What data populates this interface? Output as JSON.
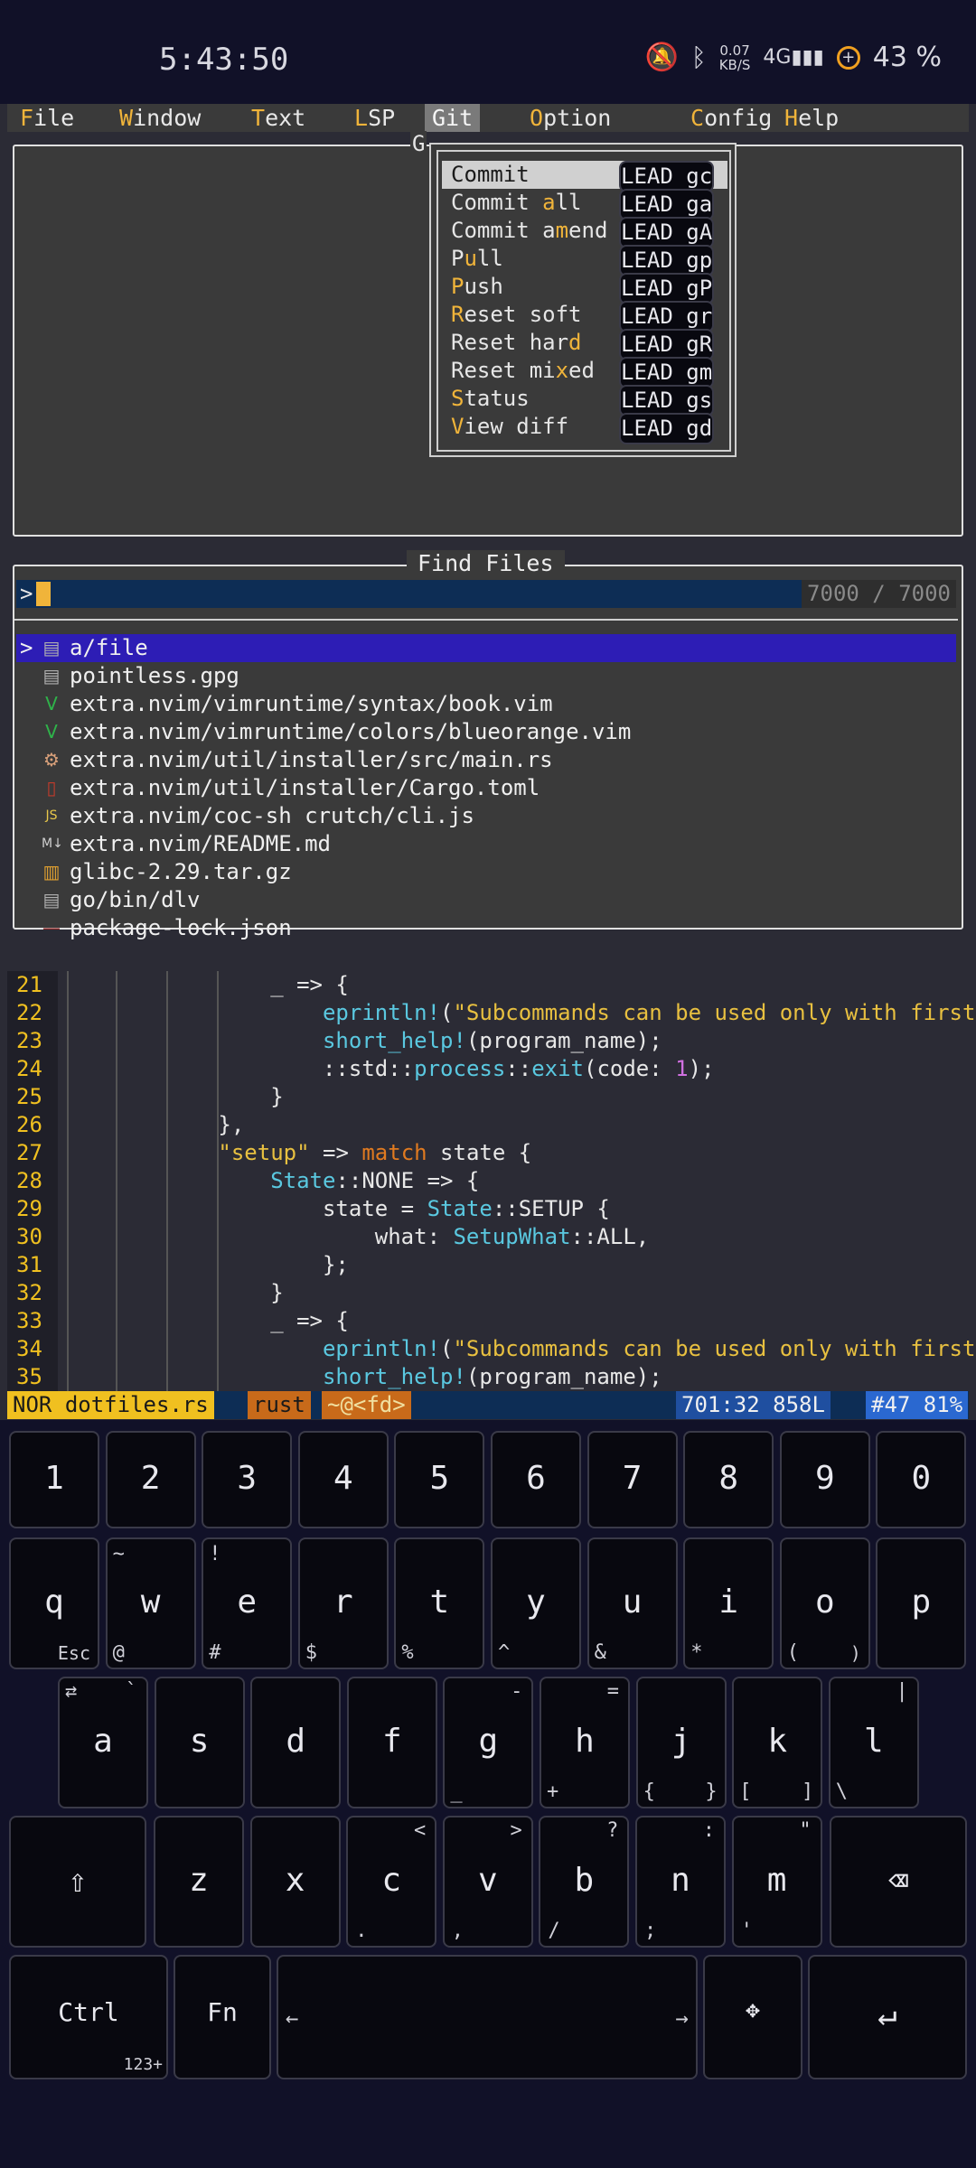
{
  "status_bar": {
    "time": "5:43:50",
    "net_speed_value": "0.07",
    "net_speed_unit": "KB/S",
    "network": "4G",
    "battery": "43 %"
  },
  "menubar": {
    "items": [
      {
        "hot": "F",
        "rest": "ile"
      },
      {
        "hot": "W",
        "rest": "indow"
      },
      {
        "hot": "T",
        "rest": "ext"
      },
      {
        "hot": "L",
        "rest": "SP"
      },
      {
        "hot": "",
        "rest": "Git"
      },
      {
        "hot": "O",
        "rest": "ption"
      },
      {
        "hot": "C",
        "rest": "onfig"
      },
      {
        "hot": "H",
        "rest": "elp"
      }
    ]
  },
  "git_panel": {
    "title": "G",
    "items": [
      {
        "pre": "Commit",
        "hot": "",
        "post": "",
        "key": "LEAD gc"
      },
      {
        "pre": "Commit ",
        "hot": "a",
        "post": "ll",
        "key": "LEAD ga"
      },
      {
        "pre": "Commit a",
        "hot": "m",
        "post": "end",
        "key": "LEAD gA"
      },
      {
        "pre": "P",
        "hot": "u",
        "post": "ll",
        "key": "LEAD gp"
      },
      {
        "pre": "",
        "hot": "P",
        "post": "ush",
        "key": "LEAD gP"
      },
      {
        "pre": "",
        "hot": "R",
        "post": "eset soft",
        "key": "LEAD gr"
      },
      {
        "pre": "Reset har",
        "hot": "d",
        "post": "",
        "key": "LEAD gR"
      },
      {
        "pre": "Reset mi",
        "hot": "x",
        "post": "ed",
        "key": "LEAD gm"
      },
      {
        "pre": "",
        "hot": "S",
        "post": "tatus",
        "key": "LEAD gs"
      },
      {
        "pre": "",
        "hot": "V",
        "post": "iew diff",
        "key": "LEAD gd"
      }
    ]
  },
  "find_files": {
    "title": "Find Files",
    "prompt": ">",
    "count": "7000 / 7000",
    "files": [
      {
        "icon": "file-icon",
        "glyph": "▤",
        "color": "#b0b0b0",
        "name": "a/file"
      },
      {
        "icon": "file-icon",
        "glyph": "▤",
        "color": "#b0b0b0",
        "name": "pointless.gpg"
      },
      {
        "icon": "vim-icon",
        "glyph": "V",
        "color": "#2fb34a",
        "name": "extra.nvim/vimruntime/syntax/book.vim"
      },
      {
        "icon": "vim-icon",
        "glyph": "V",
        "color": "#2fb34a",
        "name": "extra.nvim/vimruntime/colors/blueorange.vim"
      },
      {
        "icon": "rust-icon",
        "glyph": "⚙",
        "color": "#d9a07a",
        "name": "extra.nvim/util/installer/src/main.rs"
      },
      {
        "icon": "toml-icon",
        "glyph": "▯",
        "color": "#c23a2a",
        "name": "extra.nvim/util/installer/Cargo.toml"
      },
      {
        "icon": "js-icon",
        "glyph": "JS",
        "color": "#e8c84a",
        "name": "extra.nvim/coc-sh crutch/cli.js"
      },
      {
        "icon": "markdown-icon",
        "glyph": "M↓",
        "color": "#d0d0d0",
        "name": "extra.nvim/README.md"
      },
      {
        "icon": "archive-icon",
        "glyph": "▥",
        "color": "#e0a030",
        "name": "glibc-2.29.tar.gz"
      },
      {
        "icon": "file-icon",
        "glyph": "▤",
        "color": "#b0b0b0",
        "name": "go/bin/dlv"
      },
      {
        "icon": "json-icon",
        "glyph": "—",
        "color": "#8a2a2a",
        "name": "package-lock.json"
      }
    ]
  },
  "code": {
    "lines": [
      {
        "n": "21",
        "t": "                _ => {"
      },
      {
        "n": "22",
        "t": "                    eprintln!(\"Subcommands can be used only with first c"
      },
      {
        "n": "23",
        "t": "                    short_help!(program_name);"
      },
      {
        "n": "24",
        "t": "                    ::std::process::exit(code: 1);"
      },
      {
        "n": "25",
        "t": "                }"
      },
      {
        "n": "26",
        "t": "            },"
      },
      {
        "n": "27",
        "t": "            \"setup\" => match state {"
      },
      {
        "n": "28",
        "t": "                State::NONE => {"
      },
      {
        "n": "29",
        "t": "                    state = State::SETUP {"
      },
      {
        "n": "30",
        "t": "                        what: SetupWhat::ALL,"
      },
      {
        "n": "31",
        "t": "                    };"
      },
      {
        "n": "32",
        "t": "                }"
      },
      {
        "n": "33",
        "t": "                _ => {"
      },
      {
        "n": "34",
        "t": "                    eprintln!(\"Subcommands can be used only with first c"
      },
      {
        "n": "35",
        "t": "                    short_help!(program_name);"
      }
    ]
  },
  "vim_status": {
    "mode": "NOR",
    "filename": "dotfiles.rs",
    "filetype": "rust",
    "keys": "~@<fd>",
    "position": "701:32 858L",
    "percent": "#47 81%"
  },
  "keyboard": {
    "numbers": [
      "1",
      "2",
      "3",
      "4",
      "5",
      "6",
      "7",
      "8",
      "9",
      "0"
    ],
    "row_q": [
      {
        "k": "q",
        "tl": "",
        "bl": "",
        "br": "Esc"
      },
      {
        "k": "w",
        "tl": "~",
        "bl": "@",
        "br": ""
      },
      {
        "k": "e",
        "tl": "!",
        "bl": "#",
        "br": ""
      },
      {
        "k": "r",
        "tl": "",
        "bl": "$",
        "br": ""
      },
      {
        "k": "t",
        "tl": "",
        "bl": "%",
        "br": ""
      },
      {
        "k": "y",
        "tl": "",
        "bl": "^",
        "br": ""
      },
      {
        "k": "u",
        "tl": "",
        "bl": "&",
        "br": ""
      },
      {
        "k": "i",
        "tl": "",
        "bl": "*",
        "br": ""
      },
      {
        "k": "o",
        "tl": "",
        "bl": "(",
        "br": ")"
      },
      {
        "k": "p",
        "tl": "",
        "bl": "",
        "br": ""
      }
    ],
    "row_a": [
      {
        "k": "a",
        "tl": "⇄",
        "tr": "`",
        "bl": "",
        "br": ""
      },
      {
        "k": "s",
        "tl": "",
        "tr": "",
        "bl": "",
        "br": ""
      },
      {
        "k": "d",
        "tl": "",
        "tr": "",
        "bl": "",
        "br": ""
      },
      {
        "k": "f",
        "tl": "",
        "tr": "",
        "bl": "",
        "br": ""
      },
      {
        "k": "g",
        "tl": "",
        "tr": "-",
        "bl": "_",
        "br": ""
      },
      {
        "k": "h",
        "tl": "",
        "tr": "=",
        "bl": "+",
        "br": ""
      },
      {
        "k": "j",
        "tl": "",
        "tr": "",
        "bl": "{",
        "br": "}"
      },
      {
        "k": "k",
        "tl": "",
        "tr": "",
        "bl": "[",
        "br": "]"
      },
      {
        "k": "l",
        "tl": "",
        "tr": "|",
        "bl": "\\",
        "br": ""
      }
    ],
    "row_z": [
      {
        "k": "z",
        "tr": "",
        "bl": ""
      },
      {
        "k": "x",
        "tr": "",
        "bl": ""
      },
      {
        "k": "c",
        "tr": "<",
        "bl": "."
      },
      {
        "k": "v",
        "tr": ">",
        "bl": ","
      },
      {
        "k": "b",
        "tr": "?",
        "bl": "/"
      },
      {
        "k": "n",
        "tr": ":",
        "bl": ";"
      },
      {
        "k": "m",
        "tr": "\"",
        "bl": "'"
      }
    ],
    "ctrl": "Ctrl",
    "fn": "Fn",
    "fn_sub": "123+"
  },
  "colors": {
    "accent_yellow": "#f0c020",
    "selection_purple": "#2d1db5",
    "status_blue": "#0d2d55"
  }
}
